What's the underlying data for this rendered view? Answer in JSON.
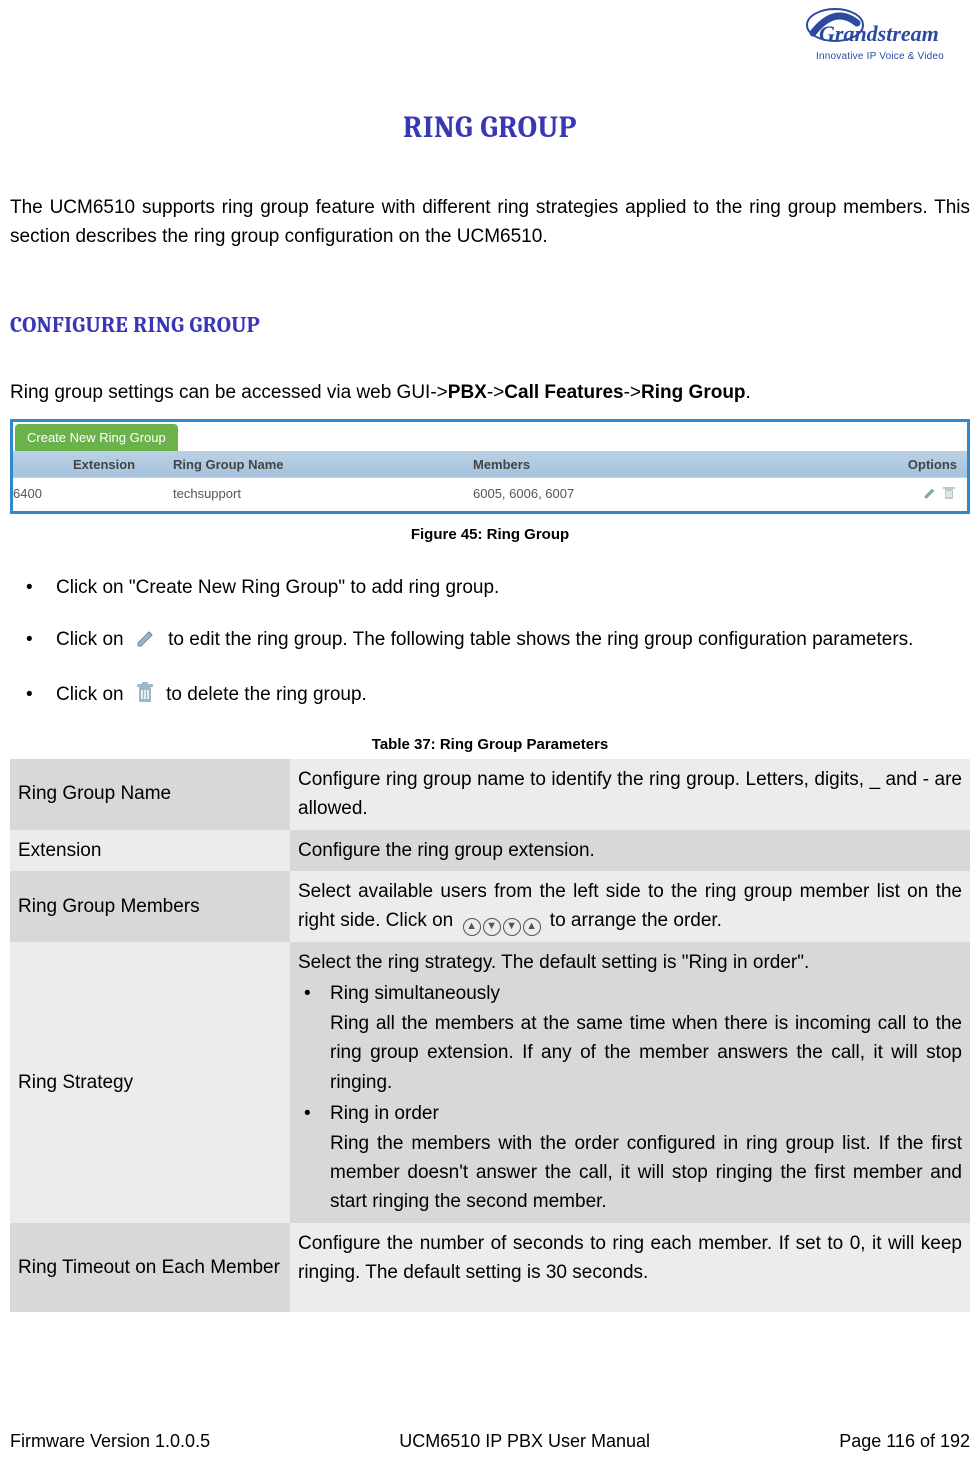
{
  "logo": {
    "brand": "Grandstream",
    "tagline": "Innovative IP Voice & Video"
  },
  "title": "RING GROUP",
  "intro": "The UCM6510 supports ring group feature with different ring strategies applied to the ring group members. This section describes the ring group configuration on the UCM6510.",
  "subtitle": "CONFIGURE RING GROUP",
  "config_line_pre": "Ring group settings can be accessed via web GUI->",
  "config_line_b1": "PBX",
  "config_line_sep1": "->",
  "config_line_b2": "Call Features",
  "config_line_sep2": "->",
  "config_line_b3": "Ring Group",
  "config_line_post": ".",
  "screenshot": {
    "button": "Create New Ring Group",
    "headers": {
      "c1": "Extension",
      "c2": "Ring Group Name",
      "c3": "Members",
      "c4": "Options"
    },
    "row": {
      "extension": "6400",
      "name": "techsupport",
      "members": "6005, 6006, 6007"
    }
  },
  "fig_caption": "Figure 45: Ring Group",
  "bullets": {
    "b1": "Click on \"Create New Ring Group\" to add ring group.",
    "b2_pre": "Click on ",
    "b2_post": " to edit the ring group. The following table shows the ring group configuration parameters.",
    "b3_pre": "Click on ",
    "b3_post": " to delete the ring group."
  },
  "table_caption": "Table 37: Ring Group Parameters",
  "params": {
    "r1": {
      "name": "Ring Group Name",
      "desc": "Configure ring group name to identify the ring group. Letters, digits, _ and - are allowed."
    },
    "r2": {
      "name": "Extension",
      "desc": "Configure the ring group extension."
    },
    "r3": {
      "name": "Ring Group Members",
      "desc_pre": "Select available users from the left side to the ring group member list on the right side. Click on ",
      "desc_post": " to arrange the order."
    },
    "r4": {
      "name": "Ring Strategy",
      "intro": "Select the ring strategy. The default setting is \"Ring in order\".",
      "li1_title": "Ring simultaneously",
      "li1_body": "Ring all the members at the same time when there is incoming call to the ring group extension. If any of the member answers the call, it will stop ringing.",
      "li2_title": "Ring in order",
      "li2_body": "Ring the members with the order configured in ring group list. If the first member doesn't answer the call, it will stop ringing the first member and start ringing the second member."
    },
    "r5": {
      "name": "Ring Timeout on Each Member",
      "desc": "Configure the number of seconds to ring each member. If set to 0, it will keep ringing. The default setting is 30 seconds."
    }
  },
  "footer": {
    "left": "Firmware Version 1.0.0.5",
    "center": "UCM6510 IP PBX User Manual",
    "right": "Page 116 of 192"
  }
}
